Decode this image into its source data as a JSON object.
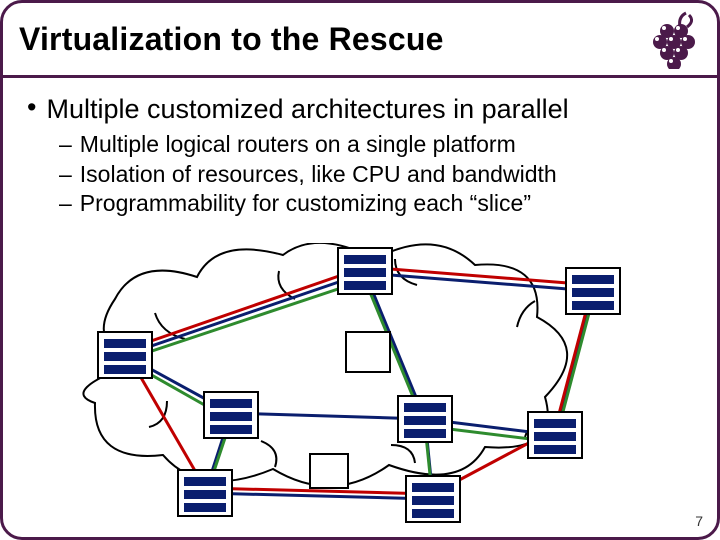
{
  "title": "Virtualization to the Rescue",
  "bullets": {
    "main": "Multiple customized architectures in parallel",
    "sub1": "Multiple logical routers on a single platform",
    "sub2": "Isolation of resources, like CPU and bandwidth",
    "sub3": "Programmability for customizing each “slice”"
  },
  "page_number": "7",
  "colors": {
    "border": "#4b1a4a",
    "blue_line": "#0a1e6e",
    "red_line": "#c00000",
    "green_line": "#2e8b2e",
    "node_stripe": "#0a1e6e"
  },
  "diagram": {
    "description": "Cloud-like network substrate with 8 router nodes connected by overlapping blue, red, and green virtual-network topologies (\"slices\").",
    "nodes": [
      "top-left",
      "top-right",
      "left",
      "center-upper",
      "center-lower",
      "right-lower",
      "bottom-left",
      "bottom-center"
    ]
  }
}
